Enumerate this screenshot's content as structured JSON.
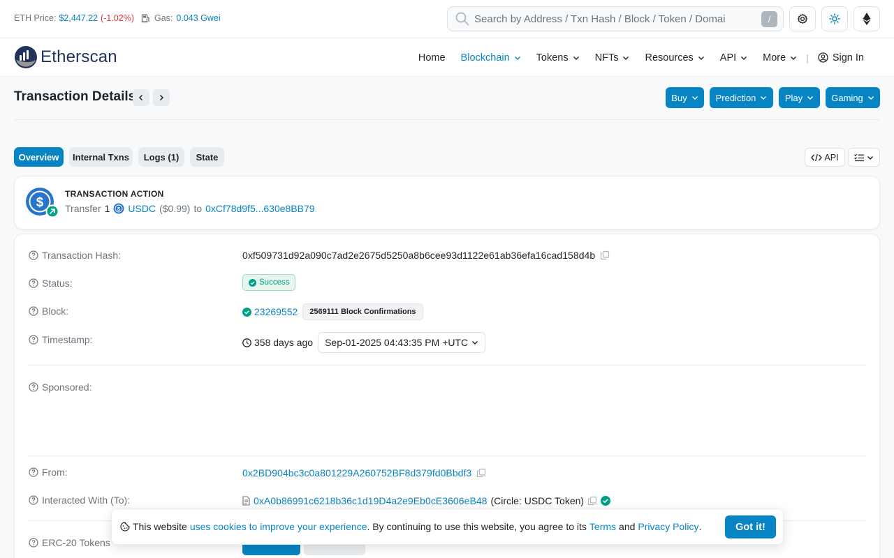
{
  "topbar": {
    "eth_price_label": "ETH Price:",
    "eth_price_value": "$2,447.22",
    "eth_price_change": "(-1.02%)",
    "gas_label": "Gas:",
    "gas_value": "0.043 Gwei",
    "search_placeholder": "Search by Address / Txn Hash / Block / Token / Domai",
    "search_shortcut": "/"
  },
  "navbar": {
    "logo_text": "Etherscan",
    "items": [
      {
        "label": "Home"
      },
      {
        "label": "Blockchain"
      },
      {
        "label": "Tokens"
      },
      {
        "label": "NFTs"
      },
      {
        "label": "Resources"
      },
      {
        "label": "API"
      },
      {
        "label": "More"
      }
    ],
    "separator": "|",
    "sign_in": "Sign In"
  },
  "page": {
    "title": "Transaction Details",
    "action_buttons": [
      "Buy",
      "Prediction",
      "Play",
      "Gaming"
    ]
  },
  "tabs": [
    "Overview",
    "Internal Txns",
    "Logs (1)",
    "State"
  ],
  "api_button": "API",
  "action": {
    "heading": "TRANSACTION ACTION",
    "verb": "Transfer",
    "amount": "1",
    "token": "USDC",
    "usd": "($0.99)",
    "to_word": "to",
    "to_address": "0xCf78d9f5...630e8BB79"
  },
  "details": {
    "hash_label": "Transaction Hash:",
    "hash_value": "0xf509731d92a090c7ad2e2675d5250a8b6cee93d1122e61ab36efa16cad158d4b",
    "status_label": "Status:",
    "status_value": "Success",
    "block_label": "Block:",
    "block_value": "23269552",
    "block_confirmations": "2569111 Block Confirmations",
    "timestamp_label": "Timestamp:",
    "timestamp_ago": "358 days ago",
    "timestamp_value": "Sep-01-2025 04:43:35 PM +UTC",
    "sponsored_label": "Sponsored:",
    "from_label": "From:",
    "from_value": "0x2BD904bc3c0a801229A260752BF8d379fd0Bbdf3",
    "to_label": "Interacted With (To):",
    "to_value": "0xA0b86991c6218b36c1d19D4a2e9Eb0cE3606eB48",
    "to_name": "(Circle: USDC Token)",
    "erc20_label": "ERC-20 Tokens"
  },
  "cookie": {
    "text1": "This website",
    "link1": "uses cookies to improve your experience",
    "text2": ". By continuing to use this website, you agree to its",
    "link2": "Terms",
    "text3": "and",
    "link3": "Privacy Policy",
    "text4": ".",
    "button": "Got it!"
  },
  "colors": {
    "primary": "#0784c3",
    "success": "#00a186",
    "danger": "#dc3545",
    "muted": "#6c757d"
  }
}
